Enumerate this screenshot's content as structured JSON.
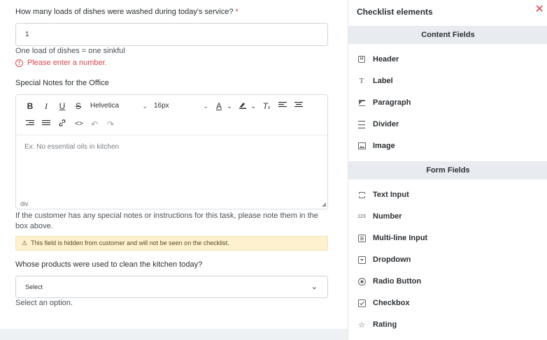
{
  "form": {
    "q1": {
      "label": "How many loads of dishes were washed during today's service?",
      "required_mark": "*",
      "value": "1",
      "hint": "One load of dishes = one sinkful",
      "error": "Please enter a number.",
      "error_icon": "!"
    },
    "q2": {
      "label": "Special Notes for the Office",
      "toolbar": {
        "font_family": "Helvetica",
        "font_size": "16px"
      },
      "placeholder": "Ex: No essential oils in kitchen",
      "footer_tag": "div",
      "note": "If the customer has any special notes or instructions for this task, please note them in the box above.",
      "warning": "This field is hidden from customer and will not be seen on the checklist."
    },
    "q3": {
      "label": "Whose products were used to clean the kitchen today?",
      "selected": "Select",
      "hint": "Select an option."
    }
  },
  "panel": {
    "title": "Checklist elements",
    "content_section": "Content Fields",
    "content_items": [
      {
        "label": "Header",
        "icon": "header-icon"
      },
      {
        "label": "Label",
        "icon": "label-icon"
      },
      {
        "label": "Paragraph",
        "icon": "paragraph-icon"
      },
      {
        "label": "Divider",
        "icon": "divider-icon"
      },
      {
        "label": "Image",
        "icon": "image-icon"
      }
    ],
    "form_section": "Form Fields",
    "form_items": [
      {
        "label": "Text Input",
        "icon": "text-input-icon"
      },
      {
        "label": "Number",
        "icon": "number-icon"
      },
      {
        "label": "Multi-line Input",
        "icon": "multiline-icon"
      },
      {
        "label": "Dropdown",
        "icon": "dropdown-icon"
      },
      {
        "label": "Radio Button",
        "icon": "radio-icon"
      },
      {
        "label": "Checkbox",
        "icon": "checkbox-icon"
      },
      {
        "label": "Rating",
        "icon": "rating-icon"
      }
    ]
  },
  "colors": {
    "accent_red": "#e0464b",
    "warning_bg": "#fdf1cf",
    "section_bg": "#e8ecf0"
  }
}
